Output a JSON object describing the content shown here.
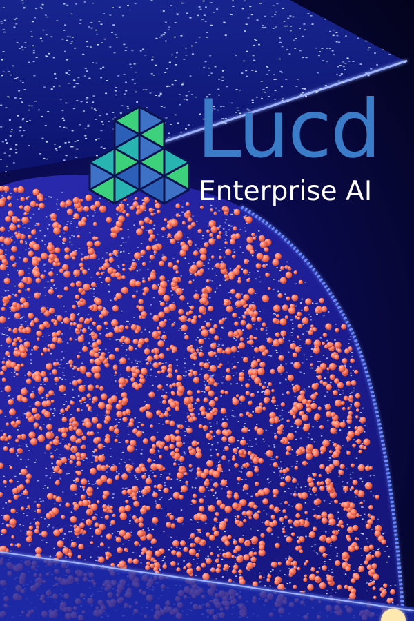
{
  "brand": {
    "name": "Lucd",
    "tagline": "Enterprise AI",
    "logo_icon": "triangle-mosaic-logo-icon",
    "colors": {
      "wordmark": "#3a7cc8",
      "tagline": "#ffffff",
      "mark_green": "#3cd17a",
      "mark_teal": "#28b4b0",
      "mark_blue": "#3d72c6"
    }
  },
  "background": {
    "particle_colors": {
      "orange": "#ff7f66",
      "blue_white": "#cfe0ff",
      "edge_glow": "#5a7dff",
      "deep_blue": "#0a0a50"
    }
  }
}
